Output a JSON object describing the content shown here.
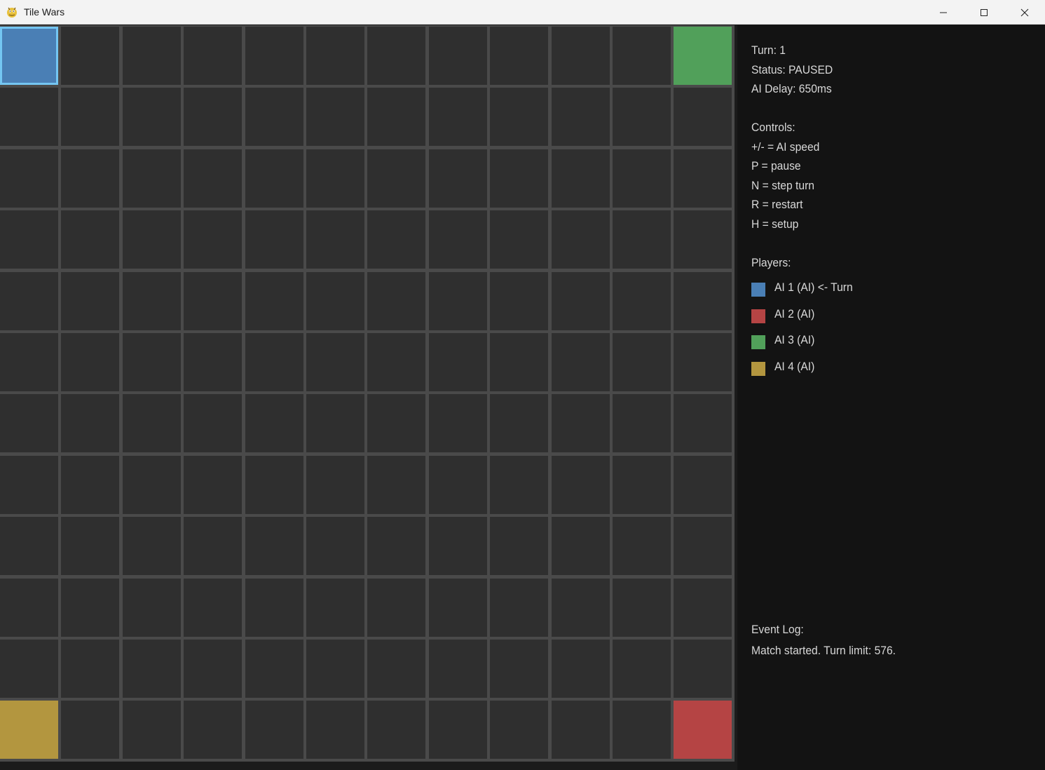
{
  "window": {
    "title": "Tile Wars",
    "icon": "pygame-snake-icon",
    "controls": [
      "minimize-icon",
      "maximize-icon",
      "close-icon"
    ]
  },
  "board": {
    "rows": 12,
    "cols": 12,
    "empty_color": "#2f2f2f",
    "grid_color": "#4a4a4a",
    "owned_cells": [
      {
        "row": 0,
        "col": 0,
        "color": "#4a7fb5",
        "selected": true,
        "highlight": "#74c6f2"
      },
      {
        "row": 0,
        "col": 11,
        "color": "#51a05a"
      },
      {
        "row": 11,
        "col": 0,
        "color": "#b3963f"
      },
      {
        "row": 11,
        "col": 11,
        "color": "#b54444"
      }
    ]
  },
  "sidebar": {
    "turn": "Turn: 1",
    "status": "Status: PAUSED",
    "ai_delay": "AI Delay: 650ms",
    "controls_header": "Controls:",
    "controls": [
      "+/- = AI speed",
      "P = pause",
      "N = step turn",
      "R = restart",
      "H = setup"
    ],
    "players_header": "Players:",
    "players": [
      {
        "label": "AI 1 (AI) <- Turn",
        "color": "#4a7fb5"
      },
      {
        "label": "AI 2 (AI)",
        "color": "#b54444"
      },
      {
        "label": "AI 3 (AI)",
        "color": "#51a05a"
      },
      {
        "label": "AI 4 (AI)",
        "color": "#b3963f"
      }
    ],
    "event_log_header": "Event Log:",
    "event_log": [
      "Match started. Turn limit: 576."
    ]
  }
}
